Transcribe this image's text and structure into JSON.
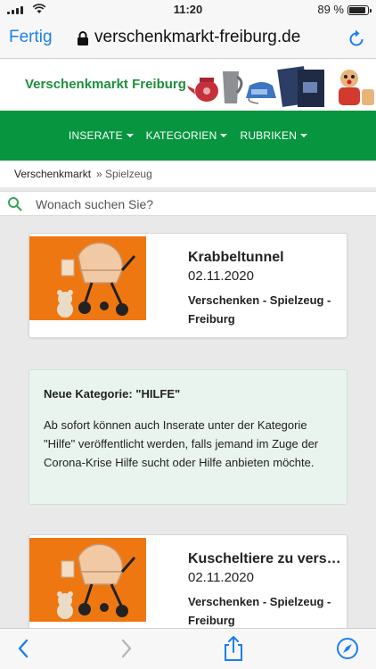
{
  "status": {
    "time": "11:20",
    "battery": "89 %",
    "battery_level": 0.89
  },
  "browser": {
    "done_label": "Fertig",
    "url": "verschenkmarkt-freiburg.de"
  },
  "site": {
    "logo": "Verschenkmarkt Freiburg"
  },
  "nav": [
    {
      "label": "INSERATE"
    },
    {
      "label": "KATEGORIEN"
    },
    {
      "label": "RUBRIKEN"
    }
  ],
  "breadcrumb": {
    "home": "Verschenkmarkt",
    "current": "» Spielzeug"
  },
  "search": {
    "placeholder": "Wonach suchen Sie?"
  },
  "listings": [
    {
      "title": "Krabbeltunnel",
      "date": "02.11.2020",
      "category": "Verschenken - Spielzeug - Freiburg"
    },
    {
      "title": "Kuscheltiere zu vers…",
      "date": "02.11.2020",
      "category": "Verschenken - Spielzeug - Freiburg"
    }
  ],
  "notice": {
    "title": "Neue Kategorie: \"HILFE\"",
    "text": "Ab sofort können auch Inserate unter der Kategorie \"Hilfe\" veröffentlicht werden, falls jemand im Zuge der Corona-Krise Hilfe sucht oder Hilfe anbieten möchte."
  },
  "colors": {
    "brand_green": "#07953f",
    "link_blue": "#1a7ff0",
    "thumb_orange": "#ef7711",
    "notice_bg": "#e9f4ee"
  }
}
